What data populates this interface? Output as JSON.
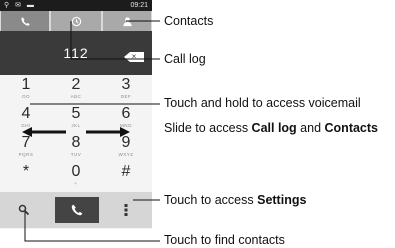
{
  "status_bar": {
    "left_icons": "⚲ ✉ ▬",
    "time": "09:21"
  },
  "dialer": {
    "number": "112",
    "delete_symbol": "×"
  },
  "tabs": [
    {
      "name": "phone",
      "icon": "phone-icon"
    },
    {
      "name": "call-log",
      "icon": "clock-icon"
    },
    {
      "name": "contacts",
      "icon": "person-icon"
    }
  ],
  "keypad": [
    {
      "digit": "1",
      "letters": "OO"
    },
    {
      "digit": "2",
      "letters": "ABC"
    },
    {
      "digit": "3",
      "letters": "DEF"
    },
    {
      "digit": "4",
      "letters": "GHI"
    },
    {
      "digit": "5",
      "letters": "JKL"
    },
    {
      "digit": "6",
      "letters": "MNO"
    },
    {
      "digit": "7",
      "letters": "PQRS"
    },
    {
      "digit": "8",
      "letters": "TUV"
    },
    {
      "digit": "9",
      "letters": "WXYZ"
    },
    {
      "digit": "*",
      "letters": ""
    },
    {
      "digit": "0",
      "letters": "+"
    },
    {
      "digit": "#",
      "letters": ""
    }
  ],
  "annotations": {
    "contacts": "Contacts",
    "call_log": "Call log",
    "voicemail": "Touch and hold to access voicemail",
    "slide_prefix": "Slide to access ",
    "slide_call_log": "Call log",
    "slide_and": " and ",
    "slide_contacts": "Contacts",
    "settings_prefix": "Touch to access ",
    "settings_bold": "Settings",
    "find_contacts": "Touch to find contacts"
  },
  "colors": {
    "display_bg": "#3a3a3a",
    "tab_active": "#8a8a8a",
    "call_button": "#444444"
  }
}
